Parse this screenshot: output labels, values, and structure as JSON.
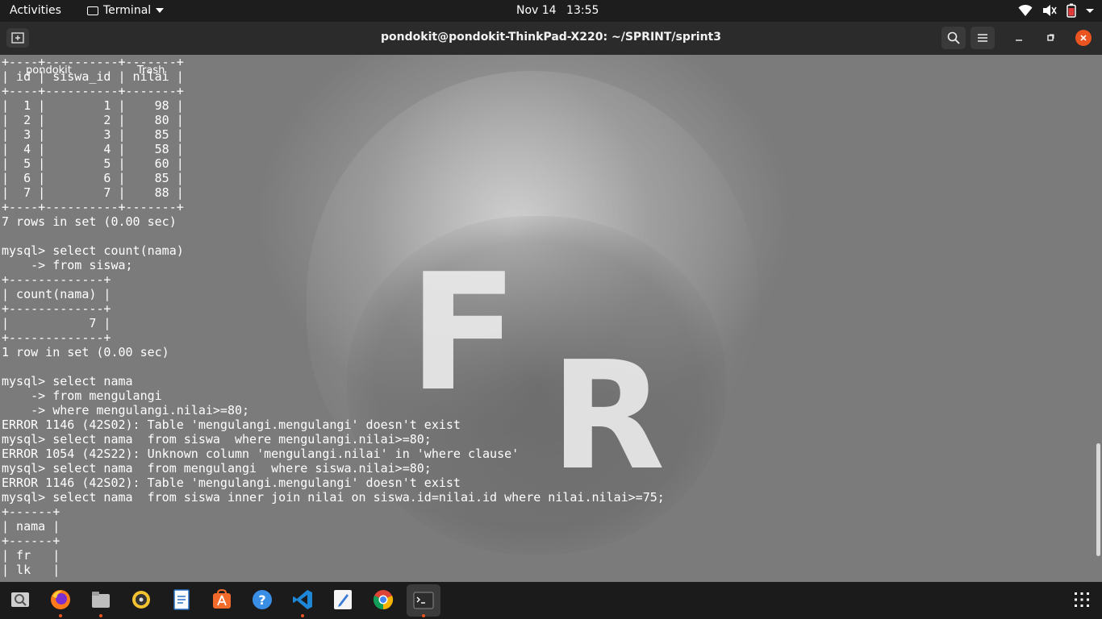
{
  "topbar": {
    "activities": "Activities",
    "app_name": "Terminal",
    "date": "Nov 14",
    "time": "13:55",
    "tray_icons": [
      "wifi-icon",
      "volume-icon",
      "battery-icon",
      "system-menu-icon"
    ]
  },
  "window": {
    "title": "pondokit@pondokit-ThinkPad-X220: ~/SPRINT/sprint3",
    "buttons": [
      "new-tab-icon",
      "search-icon",
      "hamburger-menu-icon",
      "minimize-icon",
      "maximize-icon",
      "close-icon"
    ]
  },
  "desktop": {
    "icon1_label": "pondokit",
    "icon2_label": "Trash"
  },
  "wallpaper": {
    "letter1": "F",
    "letter2": "R"
  },
  "terminal": {
    "lines": [
      "+----+----------+-------+",
      "| id | siswa_id | nilai |",
      "+----+----------+-------+",
      "|  1 |        1 |    98 |",
      "|  2 |        2 |    80 |",
      "|  3 |        3 |    85 |",
      "|  4 |        4 |    58 |",
      "|  5 |        5 |    60 |",
      "|  6 |        6 |    85 |",
      "|  7 |        7 |    88 |",
      "+----+----------+-------+",
      "7 rows in set (0.00 sec)",
      "",
      "mysql> select count(nama)",
      "    -> from siswa;",
      "+-------------+",
      "| count(nama) |",
      "+-------------+",
      "|           7 |",
      "+-------------+",
      "1 row in set (0.00 sec)",
      "",
      "mysql> select nama",
      "    -> from mengulangi",
      "    -> where mengulangi.nilai>=80;",
      "ERROR 1146 (42S02): Table 'mengulangi.mengulangi' doesn't exist",
      "mysql> select nama  from siswa  where mengulangi.nilai>=80;",
      "ERROR 1054 (42S22): Unknown column 'mengulangi.nilai' in 'where clause'",
      "mysql> select nama  from mengulangi  where siswa.nilai>=80;",
      "ERROR 1146 (42S02): Table 'mengulangi.mengulangi' doesn't exist",
      "mysql> select nama  from siswa inner join nilai on siswa.id=nilai.id where nilai.nilai>=75;",
      "+------+",
      "| nama |",
      "+------+",
      "| fr   |",
      "| lk   |"
    ]
  },
  "dock": {
    "items": [
      {
        "name": "screenshot-tool-icon",
        "running": false
      },
      {
        "name": "firefox-icon",
        "running": true
      },
      {
        "name": "files-icon",
        "running": true
      },
      {
        "name": "rhythmbox-icon",
        "running": false
      },
      {
        "name": "libreoffice-writer-icon",
        "running": false
      },
      {
        "name": "software-center-icon",
        "running": false
      },
      {
        "name": "help-icon",
        "running": false
      },
      {
        "name": "vscode-icon",
        "running": true
      },
      {
        "name": "text-editor-icon",
        "running": false
      },
      {
        "name": "chrome-icon",
        "running": false
      },
      {
        "name": "terminal-icon",
        "running": true
      }
    ],
    "apps_grid": "show-applications-icon",
    "help_glyph": "?"
  }
}
